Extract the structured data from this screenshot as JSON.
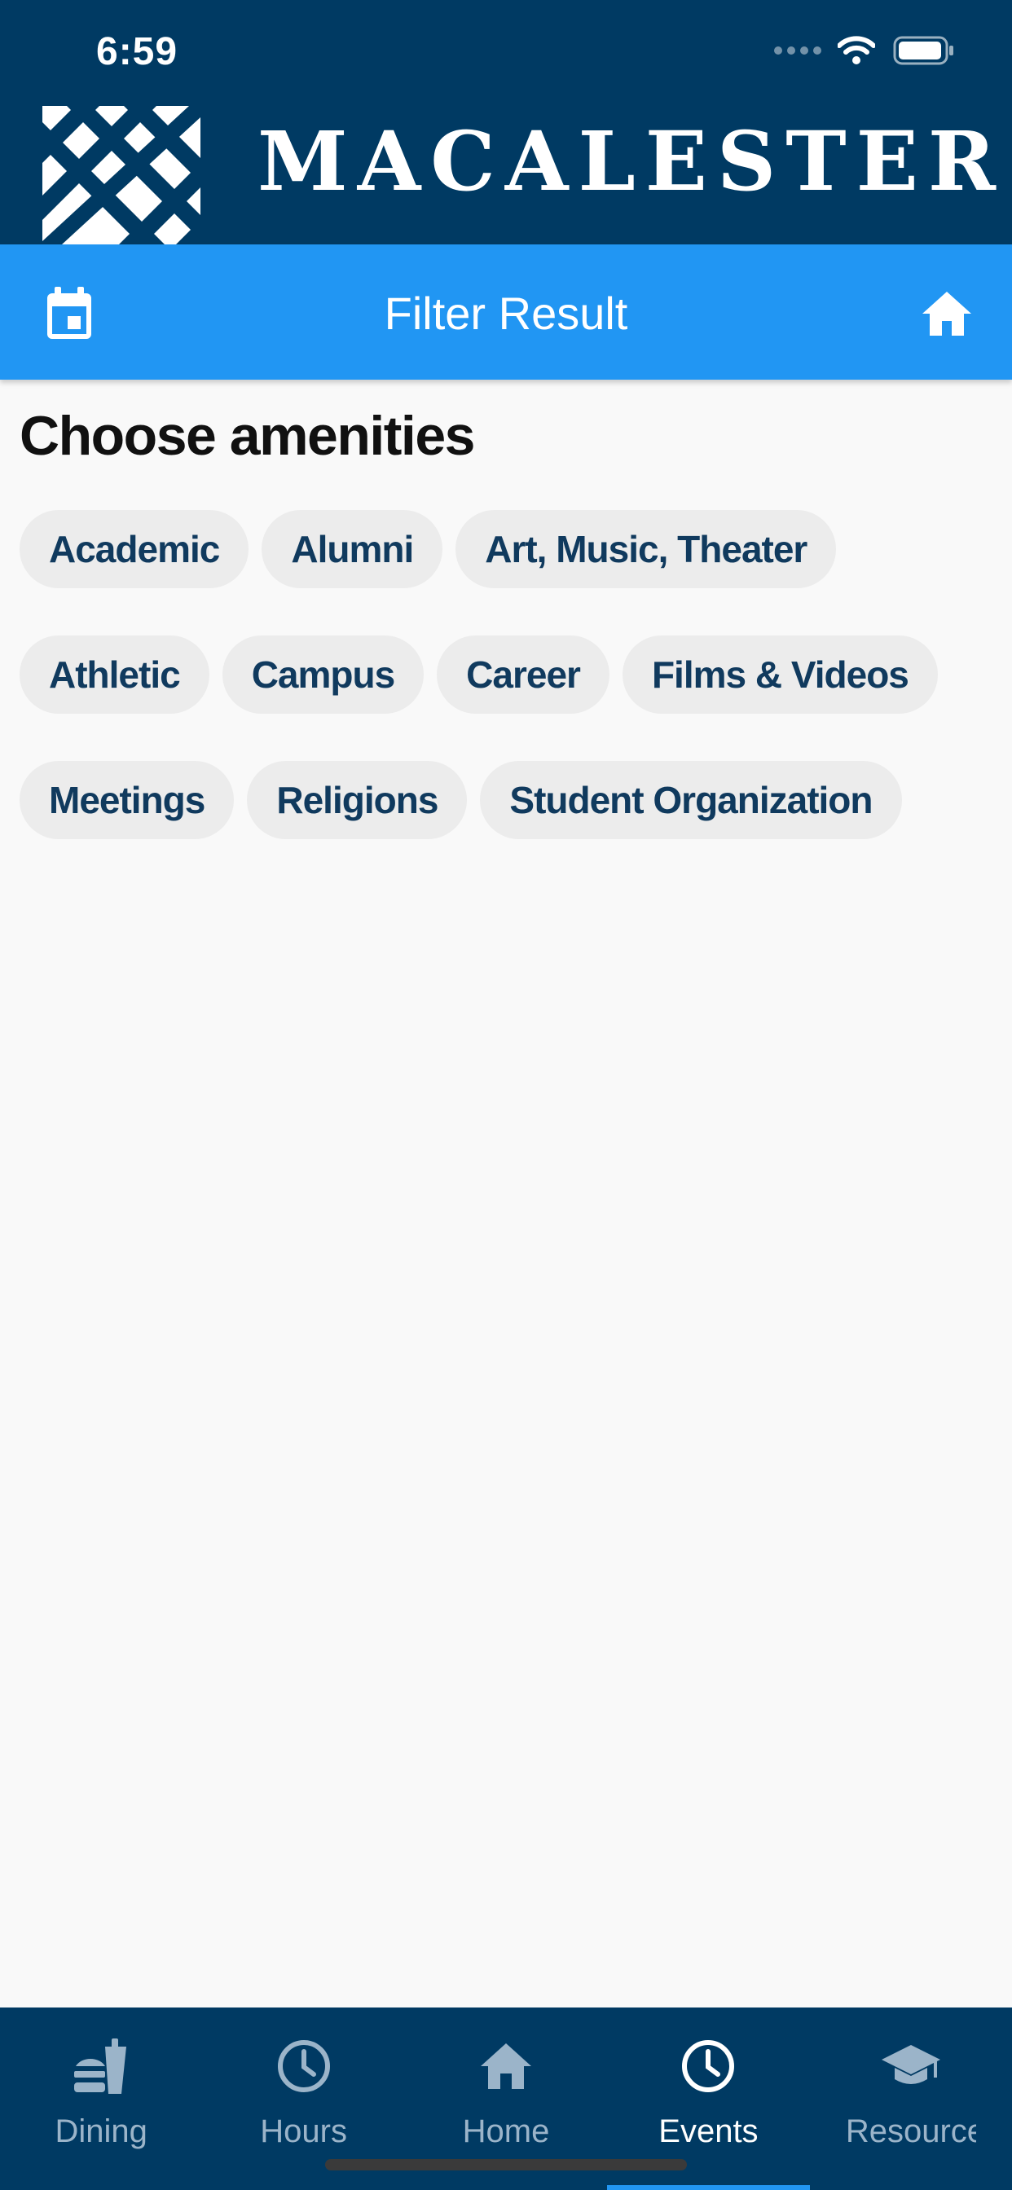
{
  "status_bar": {
    "time": "6:59"
  },
  "brand": {
    "wordmark": "MACALESTER"
  },
  "app_bar": {
    "title": "Filter Result",
    "left_icon": "calendar-icon",
    "right_icon": "home-icon"
  },
  "content": {
    "heading": "Choose amenities",
    "chips": [
      {
        "label": "Academic"
      },
      {
        "label": "Alumni"
      },
      {
        "label": "Art, Music, Theater"
      },
      {
        "label": "Athletic"
      },
      {
        "label": "Campus"
      },
      {
        "label": "Career"
      },
      {
        "label": "Films & Videos"
      },
      {
        "label": "Meetings"
      },
      {
        "label": "Religions"
      },
      {
        "label": "Student Organization"
      }
    ]
  },
  "tab_bar": {
    "active": "Events",
    "tabs": [
      {
        "label": "Dining",
        "icon": "dining-icon"
      },
      {
        "label": "Hours",
        "icon": "clock-icon"
      },
      {
        "label": "Home",
        "icon": "home-icon"
      },
      {
        "label": "Events",
        "icon": "clock-icon"
      },
      {
        "label": "Resources",
        "icon": "graduation-cap-icon"
      }
    ]
  },
  "colors": {
    "brand_navy": "#003a63",
    "app_bar_blue": "#2196f3",
    "chip_background": "#ececec",
    "chip_text": "#103a5e",
    "tab_inactive": "#9bb4c9",
    "tab_active": "#ffffff"
  }
}
